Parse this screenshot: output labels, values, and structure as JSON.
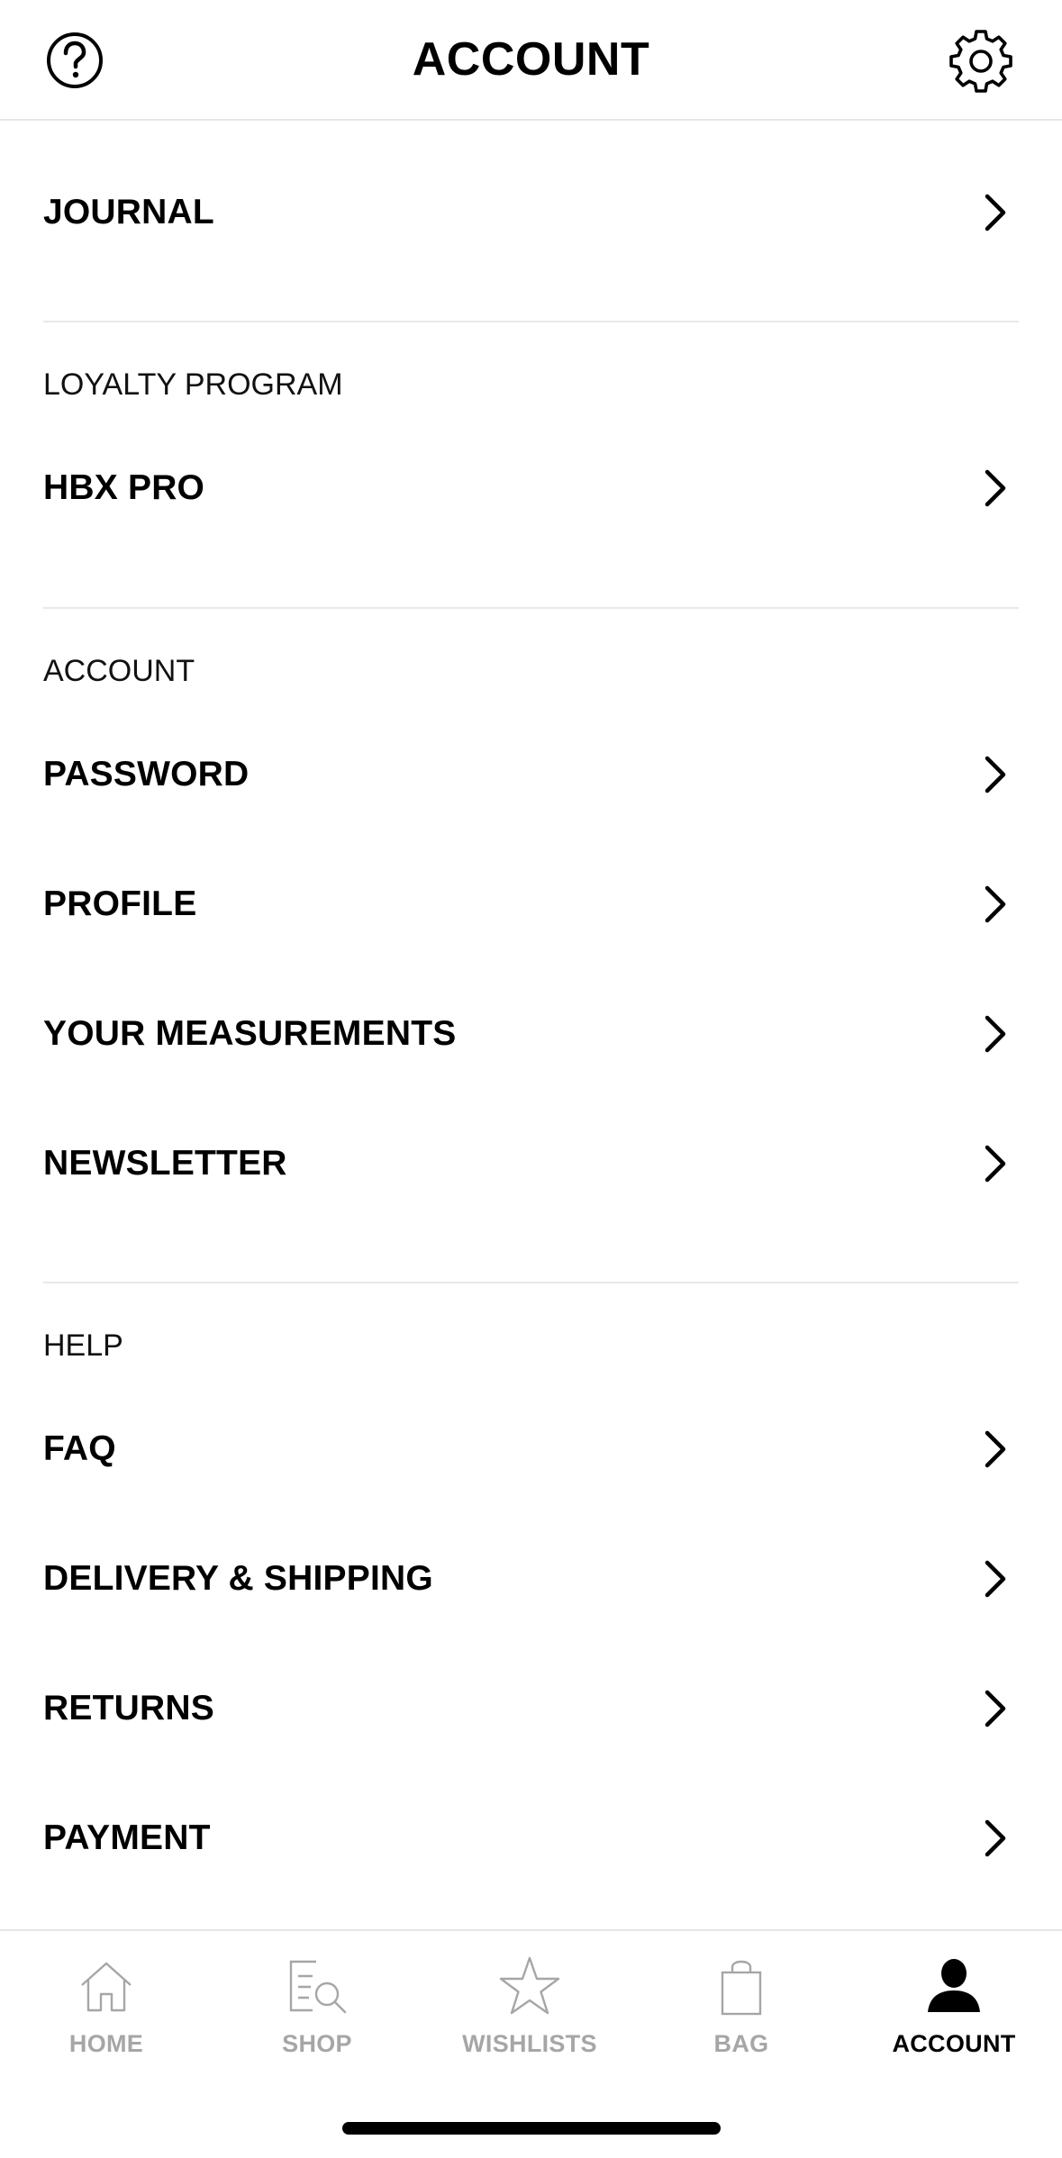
{
  "header": {
    "title": "ACCOUNT",
    "help_icon": "question-circle-icon",
    "settings_icon": "gear-icon"
  },
  "sections": [
    {
      "label": "",
      "rows": [
        {
          "label": "JOURNAL"
        }
      ]
    },
    {
      "label": "LOYALTY PROGRAM",
      "rows": [
        {
          "label": "HBX PRO"
        }
      ]
    },
    {
      "label": "ACCOUNT",
      "rows": [
        {
          "label": "PASSWORD"
        },
        {
          "label": "PROFILE"
        },
        {
          "label": "YOUR MEASUREMENTS"
        },
        {
          "label": "NEWSLETTER"
        }
      ]
    },
    {
      "label": "HELP",
      "rows": [
        {
          "label": "FAQ"
        },
        {
          "label": "DELIVERY & SHIPPING"
        },
        {
          "label": "RETURNS"
        },
        {
          "label": "PAYMENT"
        }
      ]
    }
  ],
  "tabbar": {
    "tabs": [
      {
        "label": "HOME",
        "icon": "home-icon",
        "active": false
      },
      {
        "label": "SHOP",
        "icon": "search-list-icon",
        "active": false
      },
      {
        "label": "WISHLISTS",
        "icon": "star-icon",
        "active": false
      },
      {
        "label": "BAG",
        "icon": "shopping-bag-icon",
        "active": false
      },
      {
        "label": "ACCOUNT",
        "icon": "user-icon",
        "active": true
      }
    ]
  },
  "colors": {
    "active": "#000000",
    "inactive": "#a6a6a6",
    "divider": "#e8e8e8"
  }
}
